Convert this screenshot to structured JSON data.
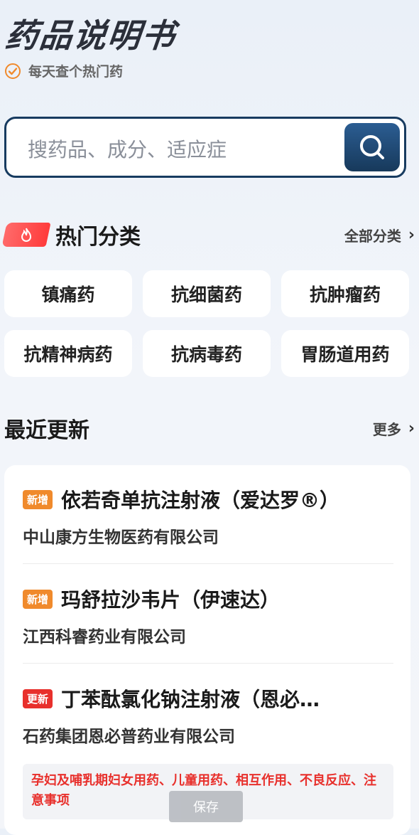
{
  "header": {
    "title": "药品说明书",
    "tagline": "每天查个热门药"
  },
  "search": {
    "placeholder": "搜药品、成分、适应症"
  },
  "hot_categories": {
    "title": "热门分类",
    "more_label": "全部分类",
    "items": [
      "镇痛药",
      "抗细菌药",
      "抗肿瘤药",
      "抗精神病药",
      "抗病毒药",
      "胃肠道用药"
    ]
  },
  "recent": {
    "title": "最近更新",
    "more_label": "更多",
    "items": [
      {
        "tag": "新增",
        "name": "依若奇单抗注射液（爱达罗®）",
        "company": "中山康方生物医药有限公司"
      },
      {
        "tag": "新增",
        "name": "玛舒拉沙韦片（伊速达）",
        "company": "江西科睿药业有限公司"
      },
      {
        "tag": "更新",
        "name": "丁苯酞氯化钠注射液（恩必…",
        "company": "石药集团恩必普药业有限公司",
        "note": "孕妇及哺乳期妇女用药、儿童用药、相互作用、不良反应、注意事项"
      }
    ]
  },
  "toast": {
    "label": "保存"
  },
  "colors": {
    "accent": "#17395b",
    "new_tag": "#f08a2c",
    "update_tag": "#e8302c",
    "hot_badge": "#ff4a4a"
  }
}
